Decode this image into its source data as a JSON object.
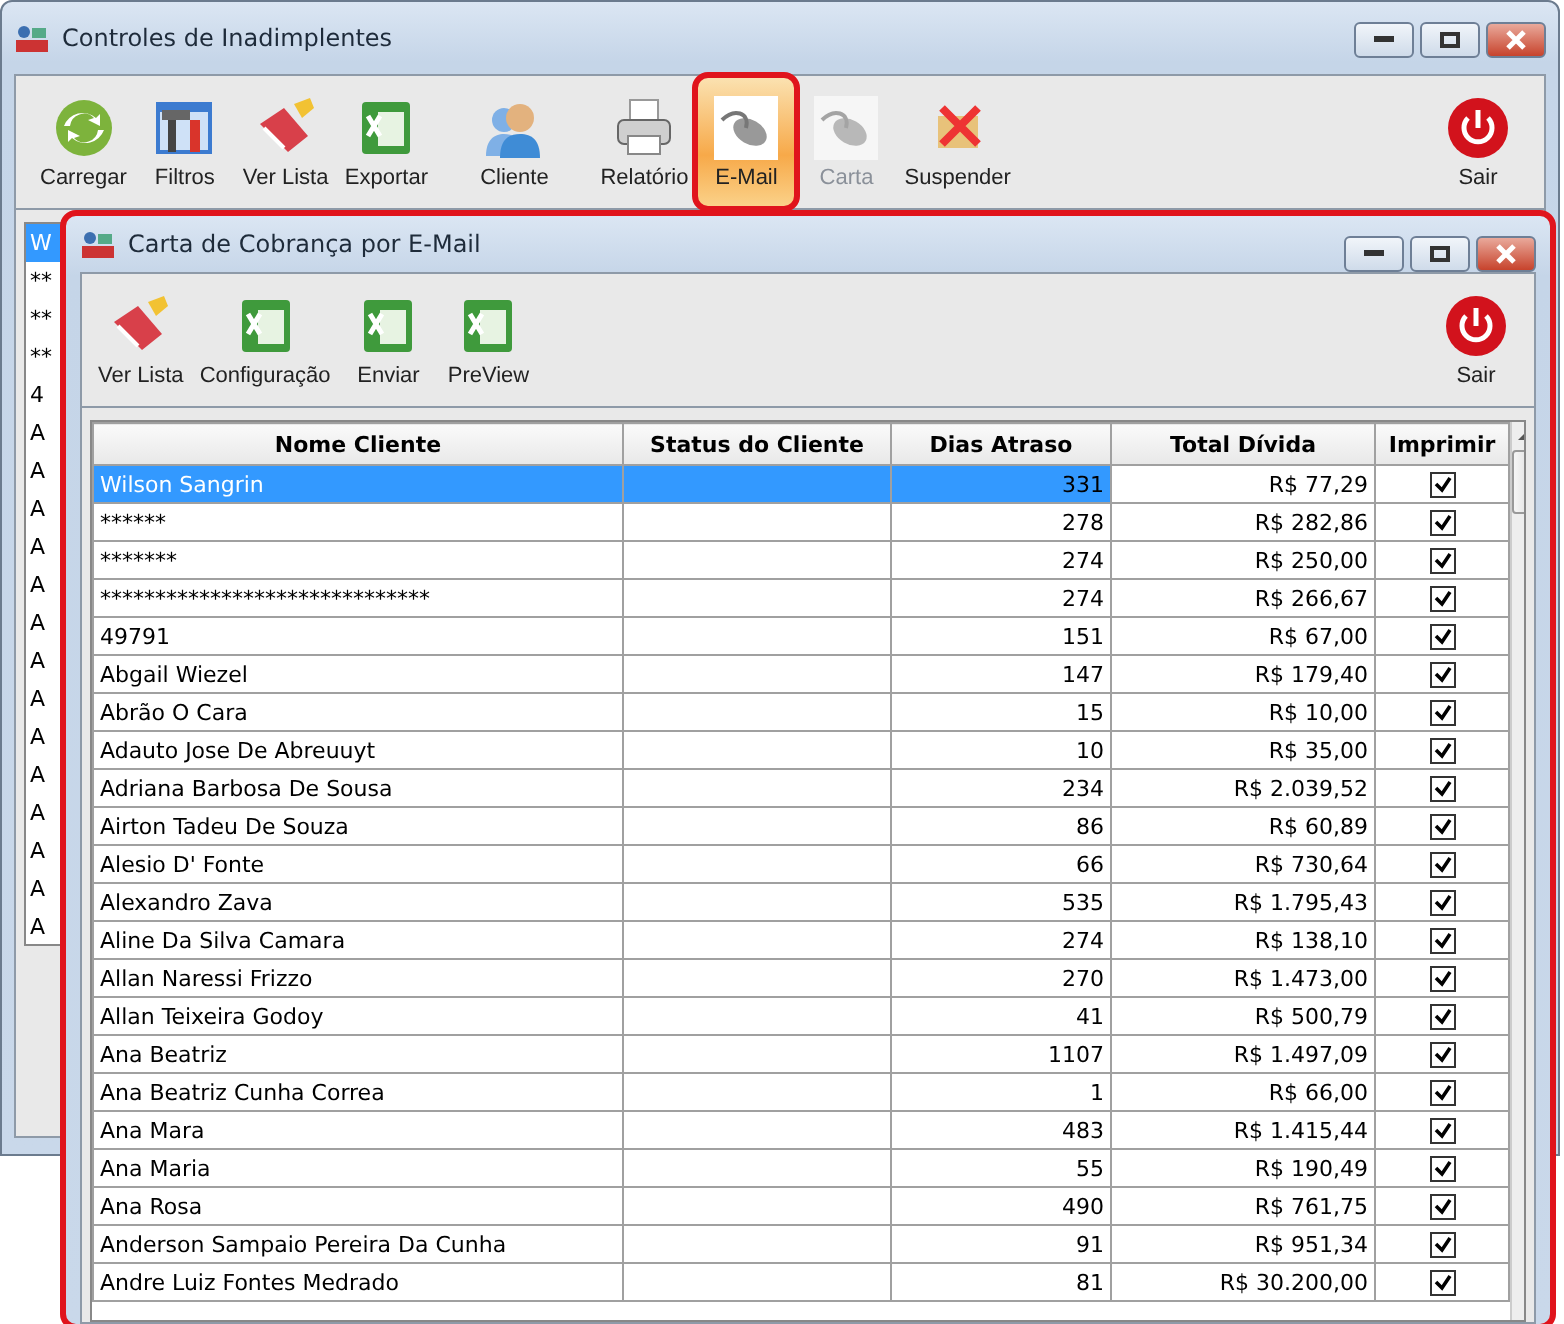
{
  "window": {
    "title": "Controles de Inadimplentes"
  },
  "toolbar": [
    {
      "label": "Carregar",
      "kind": "refresh",
      "selected": false,
      "disabled": false
    },
    {
      "label": "Filtros",
      "kind": "tools",
      "selected": false,
      "disabled": false
    },
    {
      "label": "Ver Lista",
      "kind": "eraser",
      "selected": false,
      "disabled": false
    },
    {
      "label": "Exportar",
      "kind": "excel",
      "selected": false,
      "disabled": false
    },
    {
      "label": "Cliente",
      "kind": "person",
      "selected": false,
      "disabled": false
    },
    {
      "label": "Relatório",
      "kind": "printer",
      "selected": false,
      "disabled": false
    },
    {
      "label": "E-Mail",
      "kind": "mouse",
      "selected": true,
      "disabled": false
    },
    {
      "label": "Carta",
      "kind": "mouse",
      "selected": false,
      "disabled": true
    },
    {
      "label": "Suspender",
      "kind": "cancel",
      "selected": false,
      "disabled": false
    }
  ],
  "exit_button": {
    "label": "Sair"
  },
  "back_list": [
    {
      "text": "W",
      "selected": true
    },
    {
      "text": "**",
      "selected": false
    },
    {
      "text": "**",
      "selected": false
    },
    {
      "text": "**",
      "selected": false
    },
    {
      "text": "4",
      "selected": false
    },
    {
      "text": "A",
      "selected": false
    },
    {
      "text": "A",
      "selected": false
    },
    {
      "text": "A",
      "selected": false
    },
    {
      "text": "A",
      "selected": false
    },
    {
      "text": "A",
      "selected": false
    },
    {
      "text": "A",
      "selected": false
    },
    {
      "text": "A",
      "selected": false
    },
    {
      "text": "A",
      "selected": false
    },
    {
      "text": "A",
      "selected": false
    },
    {
      "text": "A",
      "selected": false
    },
    {
      "text": "A",
      "selected": false
    },
    {
      "text": "A",
      "selected": false
    },
    {
      "text": "A",
      "selected": false
    },
    {
      "text": "A",
      "selected": false
    }
  ],
  "dialog": {
    "title": "Carta de Cobrança por E-Mail",
    "toolbar": [
      {
        "label": "Ver Lista",
        "kind": "eraser"
      },
      {
        "label": "Configuração",
        "kind": "excel"
      },
      {
        "label": "Enviar",
        "kind": "excel"
      },
      {
        "label": "PreView",
        "kind": "excel"
      }
    ],
    "exit_button": {
      "label": "Sair"
    },
    "table": {
      "columns": [
        "Nome Cliente",
        "Status do Cliente",
        "Dias Atraso",
        "Total Dívida",
        "Imprimir"
      ],
      "rows": [
        {
          "name": "Wilson Sangrin",
          "status": "",
          "days": "331",
          "total": "R$ 77,29",
          "checked": true,
          "selected": true
        },
        {
          "name": "******",
          "status": "",
          "days": "278",
          "total": "R$ 282,86",
          "checked": true,
          "selected": false
        },
        {
          "name": "*******",
          "status": "",
          "days": "274",
          "total": "R$ 250,00",
          "checked": true,
          "selected": false
        },
        {
          "name": "******************************",
          "status": "",
          "days": "274",
          "total": "R$ 266,67",
          "checked": true,
          "selected": false
        },
        {
          "name": "49791",
          "status": "",
          "days": "151",
          "total": "R$ 67,00",
          "checked": true,
          "selected": false
        },
        {
          "name": "Abgail Wiezel",
          "status": "",
          "days": "147",
          "total": "R$ 179,40",
          "checked": true,
          "selected": false
        },
        {
          "name": "Abrão O Cara",
          "status": "",
          "days": "15",
          "total": "R$ 10,00",
          "checked": true,
          "selected": false
        },
        {
          "name": "Adauto Jose De Abreuuyt",
          "status": "",
          "days": "10",
          "total": "R$ 35,00",
          "checked": true,
          "selected": false
        },
        {
          "name": "Adriana Barbosa De Sousa",
          "status": "",
          "days": "234",
          "total": "R$ 2.039,52",
          "checked": true,
          "selected": false
        },
        {
          "name": "Airton Tadeu De Souza",
          "status": "",
          "days": "86",
          "total": "R$ 60,89",
          "checked": true,
          "selected": false
        },
        {
          "name": "Alesio D' Fonte",
          "status": "",
          "days": "66",
          "total": "R$ 730,64",
          "checked": true,
          "selected": false
        },
        {
          "name": "Alexandro Zava",
          "status": "",
          "days": "535",
          "total": "R$ 1.795,43",
          "checked": true,
          "selected": false
        },
        {
          "name": "Aline Da Silva Camara",
          "status": "",
          "days": "274",
          "total": "R$ 138,10",
          "checked": true,
          "selected": false
        },
        {
          "name": "Allan Naressi Frizzo",
          "status": "",
          "days": "270",
          "total": "R$ 1.473,00",
          "checked": true,
          "selected": false
        },
        {
          "name": "Allan Teixeira Godoy",
          "status": "",
          "days": "41",
          "total": "R$ 500,79",
          "checked": true,
          "selected": false
        },
        {
          "name": "Ana Beatriz",
          "status": "",
          "days": "1107",
          "total": "R$ 1.497,09",
          "checked": true,
          "selected": false
        },
        {
          "name": "Ana Beatriz Cunha Correa",
          "status": "",
          "days": "1",
          "total": "R$ 66,00",
          "checked": true,
          "selected": false
        },
        {
          "name": "Ana Mara",
          "status": "",
          "days": "483",
          "total": "R$ 1.415,44",
          "checked": true,
          "selected": false
        },
        {
          "name": "Ana Maria",
          "status": "",
          "days": "55",
          "total": "R$ 190,49",
          "checked": true,
          "selected": false
        },
        {
          "name": "Ana Rosa",
          "status": "",
          "days": "490",
          "total": "R$ 761,75",
          "checked": true,
          "selected": false
        },
        {
          "name": "Anderson Sampaio Pereira Da Cunha",
          "status": "",
          "days": "91",
          "total": "R$ 951,34",
          "checked": true,
          "selected": false
        },
        {
          "name": "Andre Luiz Fontes Medrado",
          "status": "",
          "days": "81",
          "total": "R$ 30.200,00",
          "checked": true,
          "selected": false
        }
      ]
    }
  }
}
